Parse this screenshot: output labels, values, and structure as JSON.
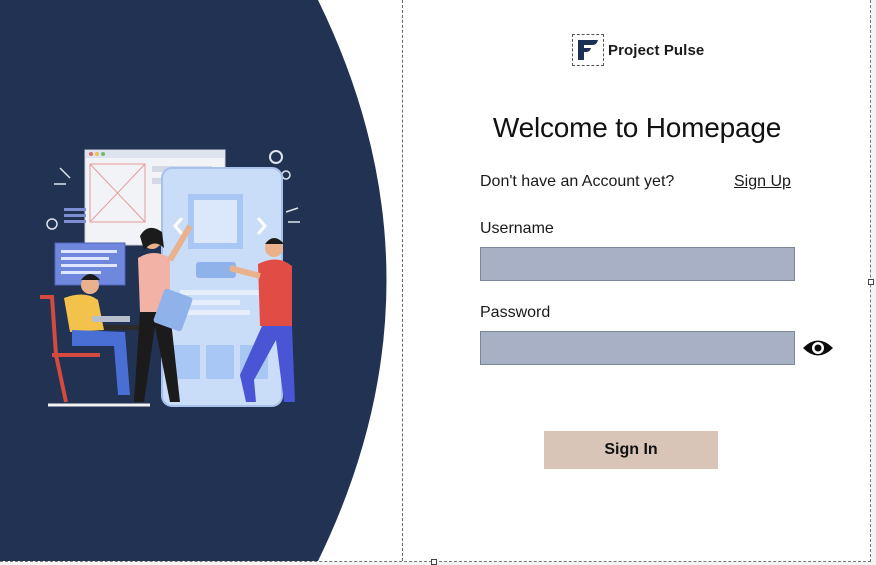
{
  "brand": {
    "name": "Project Pulse",
    "logo_icon": "project-pulse-logo"
  },
  "page": {
    "title": "Welcome to Homepage"
  },
  "signup": {
    "prompt": "Don't have an Account yet?",
    "link_label": "Sign Up"
  },
  "form": {
    "username_label": "Username",
    "username_value": "",
    "password_label": "Password",
    "password_value": "",
    "toggle_icon": "eye-icon",
    "submit_label": "Sign In"
  },
  "colors": {
    "navy": "#213253",
    "field_fill": "#a7b0c4",
    "button_fill": "#d8c5b8",
    "background": "#ffffff"
  }
}
